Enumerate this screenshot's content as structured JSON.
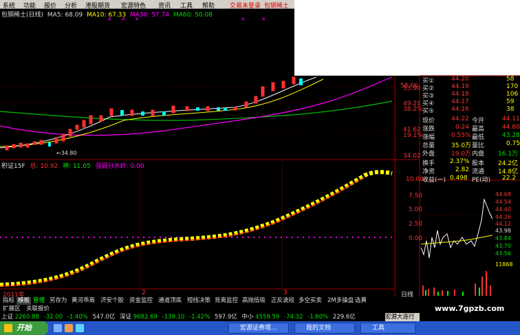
{
  "menu": {
    "items": [
      "系统",
      "功能",
      "报价",
      "分析",
      "港股期货",
      "宏源特色",
      "资讯",
      "工具",
      "帮助"
    ],
    "login_alert": "交易未登录",
    "stock_name": "包钢稀土"
  },
  "ma_line": {
    "title": "包钢稀土(日线)",
    "ma5": "MA5: 68.09",
    "ma10": "MA10: 67.33",
    "ma30": "MA30: 57.74",
    "ma60": "MA60: 50.08",
    "low_label": "←34.80"
  },
  "price_axis": [
    "58.66",
    "53.90",
    "49.21",
    "41.62",
    "34.02"
  ],
  "pct_axis": [
    "38.2%",
    "19.1%"
  ],
  "indicator": {
    "title": "积证15F",
    "v1": "总: 10.92",
    "v2": "神: 11.05",
    "v3": "强弱分水岭: 0.00",
    "axis": [
      "10.00",
      "7.50",
      "5.00",
      "2.50",
      "0.00"
    ]
  },
  "order_book": [
    {
      "label": "买①",
      "price": "44.20",
      "vol": "58"
    },
    {
      "label": "买②",
      "price": "44.19",
      "vol": "170"
    },
    {
      "label": "买③",
      "price": "44.18",
      "vol": "106"
    },
    {
      "label": "买④",
      "price": "44.17",
      "vol": "59"
    },
    {
      "label": "买⑤",
      "price": "44.16",
      "vol": "38"
    }
  ],
  "stats": [
    {
      "l1": "现价",
      "v1": "44.22",
      "l2": "今开",
      "v2": "44.11"
    },
    {
      "l1": "涨跌",
      "v1": "0.24",
      "l2": "最高",
      "v2": "44.60"
    },
    {
      "l1": "涨幅",
      "v1": "0.55%",
      "l2": "最低",
      "v2": "43.28"
    },
    {
      "l1": "总量",
      "v1": "35.0万",
      "l2": "量比",
      "v2": "0.75"
    },
    {
      "l1": "外盘",
      "v1": "19.0万",
      "l2": "内盘",
      "v2": "16.1万"
    }
  ],
  "stats2": [
    {
      "l1": "换手",
      "v1": "2.37%",
      "l2": "股本",
      "v2": "24.2亿"
    },
    {
      "l1": "净资",
      "v1": "2.82",
      "l2": "流通",
      "v2": "14.8亿"
    },
    {
      "l1": "收益(一)",
      "v1": "0.498",
      "l2": "PE(动)",
      "v2": "22.2"
    }
  ],
  "mini_axis": [
    "44.68",
    "44.54",
    "44.40",
    "44.26",
    "44.12",
    "43.98",
    "43.84",
    "43.70",
    "43.56",
    "11868"
  ],
  "date_labels": [
    "2011年",
    "2",
    "3"
  ],
  "tabs": [
    "指标",
    "模板",
    "管理",
    "另存为",
    "黄河乖离",
    "济安个股",
    "资金监控",
    "通道顶底",
    "短线决策",
    "背离监控",
    "高抛低吸",
    "正反波段",
    "多空买卖",
    "2M多操盘",
    "选黄"
  ],
  "tabs2": [
    "扩展区",
    "关联报价"
  ],
  "day_line": "日线",
  "ticker": [
    {
      "name": "上证",
      "val": "2260.88",
      "chg": "-32.00",
      "pct": "-1.40%",
      "amt": "547.0亿"
    },
    {
      "name": "深证",
      "val": "9682.69",
      "chg": "-139.10",
      "pct": "-1.42%",
      "amt": "597.9亿"
    },
    {
      "name": "中小",
      "val": "4559.59",
      "chg": "-74.32",
      "pct": "-1.60%",
      "amt": "229.6亿"
    }
  ],
  "ticker_right": "宏源大连行",
  "watermark": "www.7gpzb.com",
  "taskbar": {
    "start": "开始",
    "buttons": [
      "宏源证券增...",
      "我的文档",
      "工具"
    ]
  }
}
